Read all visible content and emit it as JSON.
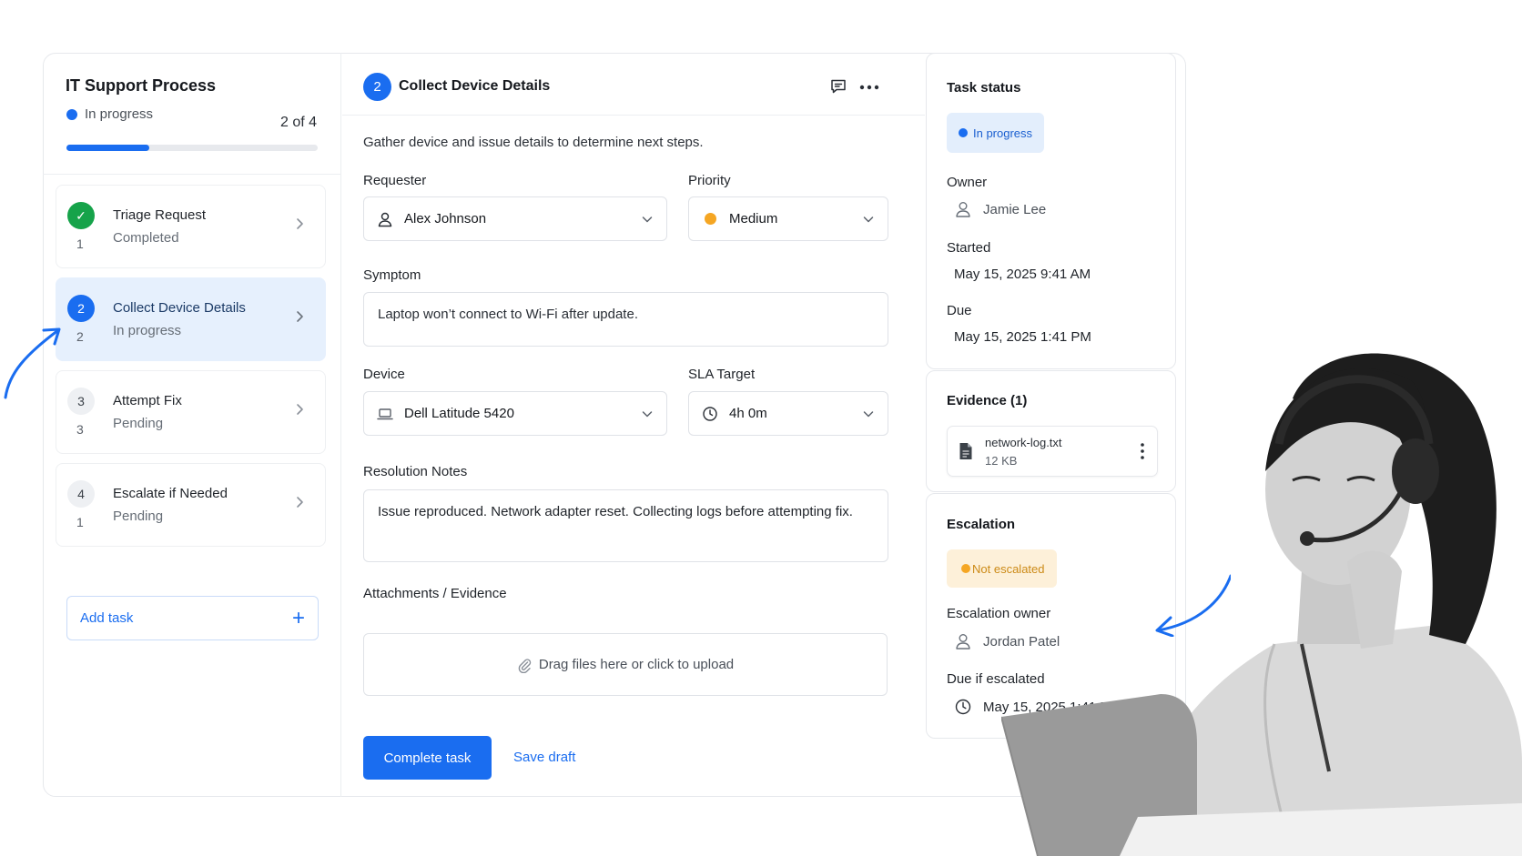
{
  "process": {
    "title": "IT Support Process",
    "status": "In progress",
    "step_count": "2 of 4",
    "progress_fraction": 0.33
  },
  "tasks": [
    {
      "name": "Triage Request",
      "status": "Completed",
      "badge": "✓",
      "num": "1"
    },
    {
      "name": "Collect Device Details",
      "status": "In progress",
      "badge": "2",
      "num": "2"
    },
    {
      "name": "Attempt Fix",
      "status": "Pending",
      "badge": "3",
      "num": "3"
    },
    {
      "name": "Escalate if Needed",
      "status": "Pending",
      "badge": "4",
      "num": "1"
    }
  ],
  "add_task_label": "Add task",
  "step": {
    "number": "2",
    "title": "Collect Device Details",
    "description": "Gather device and issue details to determine next steps."
  },
  "form": {
    "requester_label": "Requester",
    "requester_value": "Alex Johnson",
    "priority_label": "Priority",
    "priority_value": "Medium",
    "priority_color": "#f5a623",
    "symptom_label": "Symptom",
    "symptom_value": "Laptop won’t connect to Wi-Fi after update.",
    "device_label": "Device",
    "device_value": "Dell Latitude 5420",
    "sla_label": "SLA Target",
    "sla_value": "4h 0m",
    "notes_label": "Resolution Notes",
    "notes_value": "Issue reproduced. Network adapter reset. Collecting logs before attempting fix.",
    "attachments_label": "Attachments / Evidence",
    "upload_text": "Drag files here or click to upload"
  },
  "actions": {
    "complete_label": "Complete task",
    "save_draft_label": "Save draft"
  },
  "task_status": {
    "heading": "Task status",
    "status": "In progress",
    "owner_label": "Owner",
    "owner": "Jamie Lee",
    "started_label": "Started",
    "started": "May 15, 2025 9:41 AM",
    "due_label": "Due",
    "due": "May 15, 2025 1:41 PM"
  },
  "evidence": {
    "heading": "Evidence (1)",
    "file_name": "network-log.txt",
    "file_size": "12 KB"
  },
  "escalation": {
    "heading": "Escalation",
    "status": "Not escalated",
    "owner_label": "Escalation owner",
    "owner": "Jordan Patel",
    "due_label": "Due if escalated",
    "due": "May 15, 2025 1:41 PM"
  },
  "colors": {
    "accent": "#1a6df0",
    "success": "#16a34a",
    "warning": "#f5a623"
  }
}
